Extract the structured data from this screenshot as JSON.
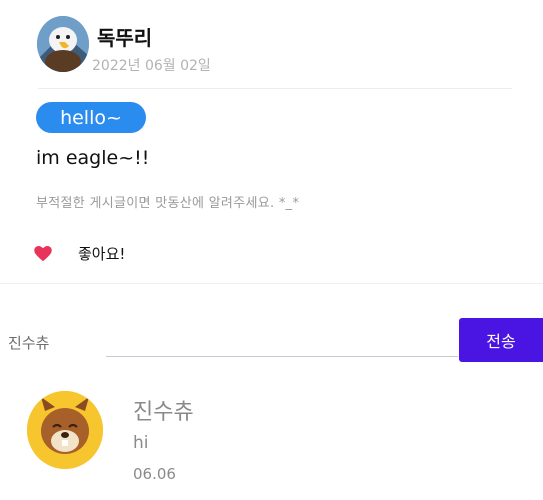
{
  "post": {
    "author": "독뚜리",
    "date": "2022년 06월 02일",
    "tag": "hello~",
    "body": "im eagle~!!",
    "notice": "부적절한 게시글이면 맛동산에 알려주세요. *_*",
    "like_label": "좋아요!",
    "author_avatar_icon": "eagle-avatar-icon",
    "like_icon": "heart-icon",
    "tag_color": "#2b8cf0",
    "heart_color": "#e8345a"
  },
  "comment_form": {
    "commenter": "진수츄",
    "input_value": "",
    "send_label": "전송",
    "send_color": "#4a14e3"
  },
  "comments": [
    {
      "name": "진수츄",
      "text": "hi",
      "date": "06.06",
      "avatar_icon": "squirrel-avatar-icon"
    }
  ]
}
